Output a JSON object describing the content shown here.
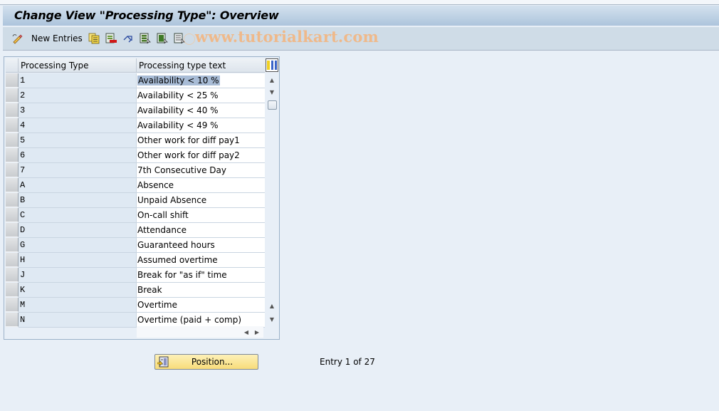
{
  "window": {
    "title": "Change View \"Processing Type\": Overview"
  },
  "toolbar": {
    "new_entries_label": "New Entries",
    "icons": [
      "edit-pencil-icon",
      "copy-as-icon",
      "delete-icon",
      "undo-change-icon",
      "select-all-icon",
      "select-block-icon",
      "deselect-all-icon"
    ],
    "watermark": "www.tutorialkart.com"
  },
  "table": {
    "columns": [
      "Processing Type",
      "Processing type text"
    ],
    "selected_text": "Availability < 10 %",
    "rows": [
      {
        "type": "1",
        "text": "Availability < 10 %"
      },
      {
        "type": "2",
        "text": "Availability < 25 %"
      },
      {
        "type": "3",
        "text": "Availability < 40 %"
      },
      {
        "type": "4",
        "text": "Availability < 49 %"
      },
      {
        "type": "5",
        "text": "Other work for diff pay1"
      },
      {
        "type": "6",
        "text": "Other work for diff pay2"
      },
      {
        "type": "7",
        "text": "7th Consecutive Day"
      },
      {
        "type": "A",
        "text": "Absence"
      },
      {
        "type": "B",
        "text": "Unpaid Absence"
      },
      {
        "type": "C",
        "text": "On-call shift"
      },
      {
        "type": "D",
        "text": "Attendance"
      },
      {
        "type": "G",
        "text": "Guaranteed hours"
      },
      {
        "type": "H",
        "text": "Assumed overtime"
      },
      {
        "type": "J",
        "text": "Break for \"as if\" time"
      },
      {
        "type": "K",
        "text": "Break"
      },
      {
        "type": "M",
        "text": "Overtime"
      },
      {
        "type": "N",
        "text": "Overtime (paid + comp)"
      }
    ]
  },
  "footer": {
    "position_button_label": "Position...",
    "entry_status": "Entry 1 of 27"
  }
}
